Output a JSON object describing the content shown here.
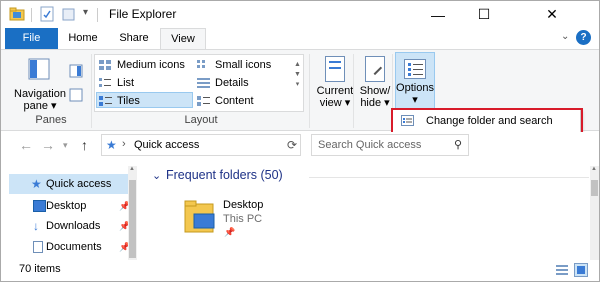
{
  "window": {
    "title": "File Explorer",
    "minimize_glyph": "—",
    "maximize_glyph": "☐",
    "close_glyph": "✕"
  },
  "ribbon_tabs": {
    "file": "File",
    "home": "Home",
    "share": "Share",
    "view": "View"
  },
  "ribbon": {
    "panes": {
      "navigation_pane_label_1": "Navigation",
      "navigation_pane_label_2": "pane ▾",
      "group_label": "Panes"
    },
    "layout": {
      "items": [
        {
          "label": "Medium icons"
        },
        {
          "label": "Small icons"
        },
        {
          "label": "List"
        },
        {
          "label": "Details"
        },
        {
          "label": "Tiles"
        },
        {
          "label": "Content"
        }
      ],
      "selected": "Tiles",
      "group_label": "Layout"
    },
    "current_view": {
      "line1": "Current",
      "line2": "view ▾"
    },
    "show_hide": {
      "line1": "Show/",
      "line2": "hide ▾"
    },
    "options": {
      "line1": "Options",
      "line2": "▾"
    }
  },
  "dropdown": {
    "item": "Change folder and search options"
  },
  "address_bar": {
    "path": "Quick access",
    "search_placeholder": "Search Quick access"
  },
  "nav_pane": {
    "items": [
      {
        "label": "Quick access"
      },
      {
        "label": "Desktop"
      },
      {
        "label": "Downloads"
      },
      {
        "label": "Documents"
      }
    ]
  },
  "content": {
    "section_title": "Frequent folders (50)",
    "folder": {
      "name": "Desktop",
      "location": "This PC"
    }
  },
  "status": {
    "item_count": "70 items"
  },
  "colors": {
    "accent": "#1a6fc4",
    "highlight": "#cce4f7",
    "outline": "#d81b2a",
    "section_title": "#1e3287"
  }
}
